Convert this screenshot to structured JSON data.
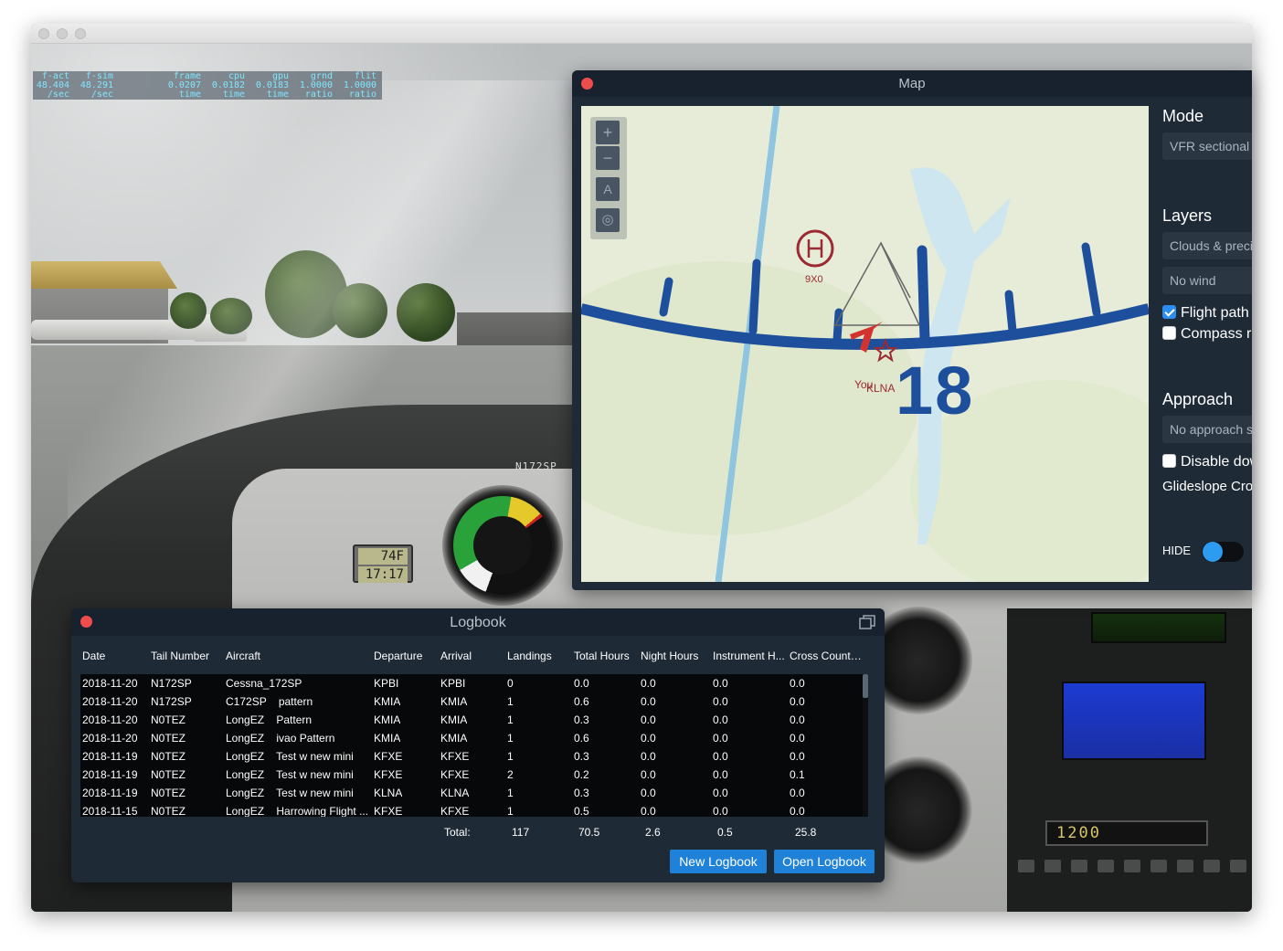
{
  "stats": {
    "columns": [
      {
        "lines": [
          "f-act",
          "48.404",
          "/sec"
        ]
      },
      {
        "lines": [
          "f-sim",
          "48.291",
          "/sec"
        ]
      },
      {
        "lines": [
          "frame",
          "0.0207",
          "time"
        ]
      },
      {
        "lines": [
          "cpu",
          "0.0182",
          "time"
        ]
      },
      {
        "lines": [
          "gpu",
          "0.0183",
          "time"
        ]
      },
      {
        "lines": [
          "grnd",
          "1.0000",
          "ratio"
        ]
      },
      {
        "lines": [
          "flit",
          "1.0000",
          "ratio"
        ]
      }
    ]
  },
  "cockpit": {
    "tail_number": "N172SP",
    "clock_top": "74F",
    "clock_bottom": "17:17",
    "transponder": "1200"
  },
  "map": {
    "title": "Map",
    "labels": {
      "heliport": "9X0",
      "you": "You",
      "airport": "KLNA",
      "runway": "18"
    },
    "sidebar": {
      "mode_heading": "Mode",
      "mode_value": "VFR sectional",
      "layers_heading": "Layers",
      "layer_weather": "Clouds & precip",
      "layer_wind": "No wind",
      "flight_path": "Flight path",
      "compass": "Compass rose",
      "approach_heading": "Approach",
      "approach_value": "No approach selected",
      "disable_down": "Disable downloads",
      "glideslope": "Glideslope Cross",
      "toggle_label": "HIDE"
    }
  },
  "logbook": {
    "title": "Logbook",
    "columns": [
      "Date",
      "Tail Number",
      "Aircraft",
      "Departure",
      "Arrival",
      "Landings",
      "Total Hours",
      "Night Hours",
      "Instrument H...",
      "Cross Countr..."
    ],
    "rows": [
      [
        "2018-11-20",
        "N172SP",
        "Cessna_172SP",
        "KPBI",
        "KPBI",
        "0",
        "0.0",
        "0.0",
        "0.0",
        "0.0"
      ],
      [
        "2018-11-20",
        "N172SP",
        "C172SP    pattern",
        "KMIA",
        "KMIA",
        "1",
        "0.6",
        "0.0",
        "0.0",
        "0.0"
      ],
      [
        "2018-11-20",
        "N0TEZ",
        "LongEZ    Pattern",
        "KMIA",
        "KMIA",
        "1",
        "0.3",
        "0.0",
        "0.0",
        "0.0"
      ],
      [
        "2018-11-20",
        "N0TEZ",
        "LongEZ    ivao Pattern",
        "KMIA",
        "KMIA",
        "1",
        "0.6",
        "0.0",
        "0.0",
        "0.0"
      ],
      [
        "2018-11-19",
        "N0TEZ",
        "LongEZ    Test w new mini",
        "KFXE",
        "KFXE",
        "1",
        "0.3",
        "0.0",
        "0.0",
        "0.0"
      ],
      [
        "2018-11-19",
        "N0TEZ",
        "LongEZ    Test w new mini",
        "KFXE",
        "KFXE",
        "2",
        "0.2",
        "0.0",
        "0.0",
        "0.1"
      ],
      [
        "2018-11-19",
        "N0TEZ",
        "LongEZ    Test w new mini",
        "KLNA",
        "KLNA",
        "1",
        "0.3",
        "0.0",
        "0.0",
        "0.0"
      ],
      [
        "2018-11-15",
        "N0TEZ",
        "LongEZ    Harrowing Flight ...",
        "KFXE",
        "KFXE",
        "1",
        "0.5",
        "0.0",
        "0.0",
        "0.0"
      ]
    ],
    "totals": {
      "label": "Total:",
      "landings": "117",
      "total_hours": "70.5",
      "night_hours": "2.6",
      "instrument_hours": "0.5",
      "cross_country": "25.8"
    },
    "buttons": {
      "new": "New Logbook",
      "open": "Open Logbook"
    }
  }
}
